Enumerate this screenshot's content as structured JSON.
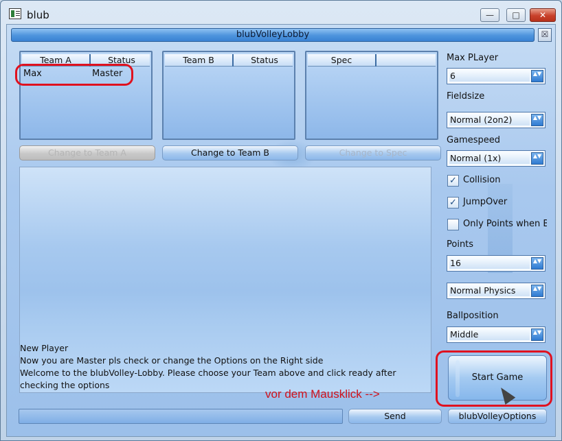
{
  "window": {
    "title": "blub",
    "controls": {
      "minimize": "—",
      "maximize": "□",
      "close": "✕"
    }
  },
  "lobby": {
    "title": "blubVolleyLobby",
    "close_glyph": "☒"
  },
  "team_a": {
    "headers": [
      "Team A",
      "Status"
    ],
    "rows": [
      {
        "name": "Max",
        "status": "Master"
      }
    ]
  },
  "team_b": {
    "headers": [
      "Team B",
      "Status"
    ]
  },
  "spec": {
    "headers": [
      "Spec",
      ""
    ]
  },
  "buttons": {
    "change_team_a": "Change to Team A",
    "change_team_b": "Change to Team B",
    "change_spec": "Change to Spec",
    "send": "Send",
    "options": "blubVolleyOptions",
    "start": "Start Game"
  },
  "chat": {
    "lines": [
      "New Player",
      "Now you are Master pls check or change the Options on the Right side",
      "Welcome to the blubVolley-Lobby. Please choose your Team above and click ready after",
      "checking the options"
    ],
    "input_value": ""
  },
  "annotation": "vor dem Mausklick -->",
  "settings": {
    "max_player": {
      "label": "Max PLayer",
      "value": "6"
    },
    "fieldsize": {
      "label": "Fieldsize",
      "value": "Normal (2on2)"
    },
    "gamespeed": {
      "label": "Gamespeed",
      "value": "Normal (1x)"
    },
    "collision": {
      "label": "Collision",
      "checked": true
    },
    "jumpover": {
      "label": "JumpOver",
      "checked": true
    },
    "only_points": {
      "label": "Only Points when Bc",
      "checked": false
    },
    "points": {
      "label": "Points",
      "value": "16"
    },
    "physics": {
      "value": "Normal Physics"
    },
    "ballposition": {
      "label": "Ballposition",
      "value": "Middle"
    }
  },
  "glyphs": {
    "check": "✓",
    "combo_arrows": "▲▼"
  },
  "colors": {
    "accent_blue": "#3a82d3",
    "highlight_red": "#e0111f",
    "close_red": "#c8402a"
  }
}
